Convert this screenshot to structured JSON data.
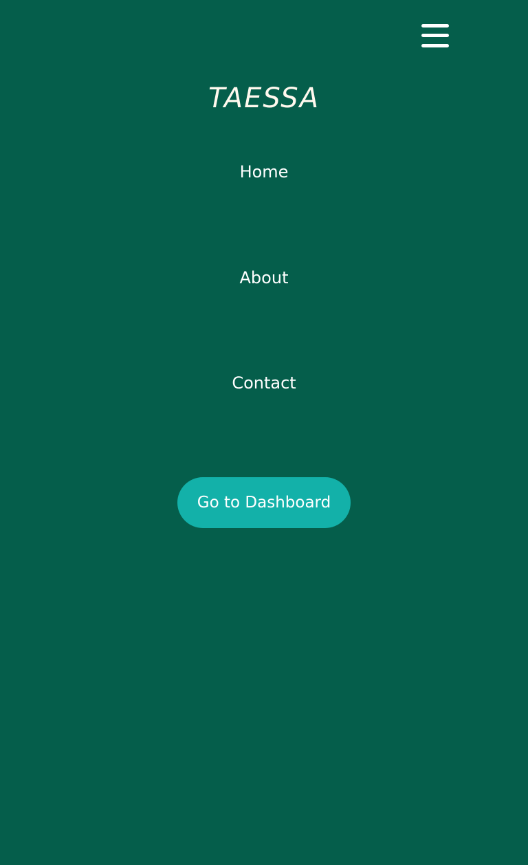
{
  "brand": {
    "name": "TAESSA"
  },
  "header": {
    "menu_icon": "hamburger-menu-icon"
  },
  "nav": {
    "items": [
      {
        "label": "Home"
      },
      {
        "label": "About"
      },
      {
        "label": "Contact"
      }
    ]
  },
  "cta": {
    "label": "Go to Dashboard"
  },
  "colors": {
    "background": "#055e4b",
    "button": "#13b1a9",
    "text": "#ffffff"
  }
}
